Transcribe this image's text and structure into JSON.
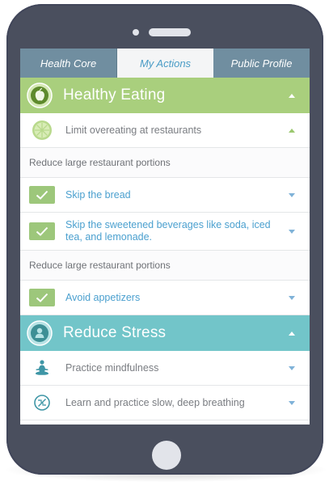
{
  "tabs": [
    {
      "label": "Health Core",
      "active": false
    },
    {
      "label": "My Actions",
      "active": true
    },
    {
      "label": "Public Profile",
      "active": false
    }
  ],
  "categories": [
    {
      "title": "Healthy Eating",
      "color": "#a9cf7d",
      "icon": "apple-icon"
    },
    {
      "title": "Reduce Stress",
      "color": "#72c5c9",
      "icon": "person-icon"
    }
  ],
  "healthy_eating": {
    "goal": {
      "label": "Limit overeating at restaurants",
      "icon": "lime-slice-icon"
    },
    "group1": {
      "heading": "Reduce large restaurant portions",
      "actions": [
        {
          "label": "Skip the bread",
          "checked": true
        },
        {
          "label": "Skip the sweetened beverages like soda, iced tea, and lemonade.",
          "checked": true
        }
      ]
    },
    "group2": {
      "heading": "Reduce large restaurant portions",
      "actions": [
        {
          "label": "Avoid appetizers",
          "checked": true
        }
      ]
    }
  },
  "reduce_stress": {
    "items": [
      {
        "label": "Practice mindfulness",
        "icon": "meditation-icon"
      },
      {
        "label": "Learn and practice slow, deep breathing",
        "icon": "breathing-icon"
      }
    ]
  }
}
